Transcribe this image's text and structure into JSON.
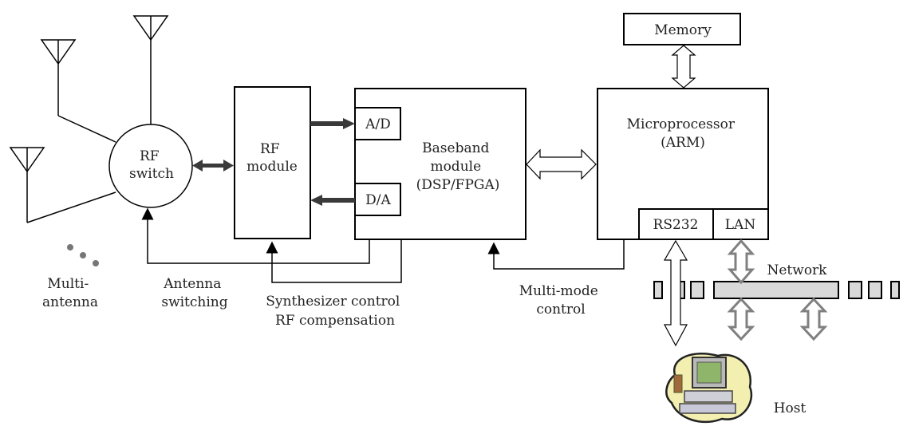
{
  "diagram": {
    "blocks": {
      "rf_switch": [
        "RF",
        "switch"
      ],
      "rf_module": [
        "RF",
        "module"
      ],
      "ad": "A/D",
      "da": "D/A",
      "baseband": [
        "Baseband",
        "module",
        "(DSP/FPGA)"
      ],
      "memory": "Memory",
      "microprocessor": [
        "Microprocessor",
        "(ARM)"
      ],
      "rs232": "RS232",
      "lan": "LAN"
    },
    "labels": {
      "multi_antenna": [
        "Multi-",
        "antenna"
      ],
      "antenna_switching": [
        "Antenna",
        "switching"
      ],
      "synth_control": [
        "Synthesizer control",
        "RF compensation"
      ],
      "multi_mode": [
        "Multi-mode",
        "control"
      ],
      "network": "Network",
      "host": "Host"
    },
    "colors": {
      "line": "#000000",
      "dark_arrow": "#3a3a3a",
      "gray_arrow": "#808080",
      "network_fill": "#d9d9d9",
      "dots": "#777777"
    }
  }
}
